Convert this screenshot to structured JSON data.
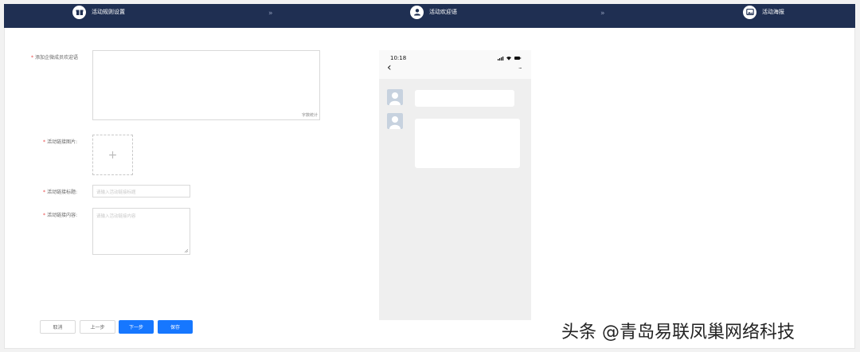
{
  "steps": [
    {
      "label": "活动规则设置",
      "icon": "gift-icon"
    },
    {
      "label": "活动欢迎语",
      "icon": "user-chat-icon"
    },
    {
      "label": "活动海报",
      "icon": "image-icon"
    }
  ],
  "step_separator": "»",
  "form": {
    "welcome_label": "添加企微成员欢迎语",
    "welcome_counter": "字数统计",
    "image_label": "活动链接图片:",
    "upload_symbol": "+",
    "title_label": "活动链接标题:",
    "title_placeholder": "请输入活动链接标题",
    "content_label": "活动链接内容:",
    "content_placeholder": "请输入活动链接内容"
  },
  "buttons": {
    "cancel": "取消",
    "prev": "上一步",
    "next": "下一步",
    "save": "保存"
  },
  "preview": {
    "time": "10:18",
    "back_symbol": "‹",
    "more_symbol": "···"
  },
  "colors": {
    "stepbar": "#1f2f52",
    "primary": "#1677ff",
    "required": "#e84545"
  },
  "watermark": "头条 @青岛易联凤巢网络科技"
}
